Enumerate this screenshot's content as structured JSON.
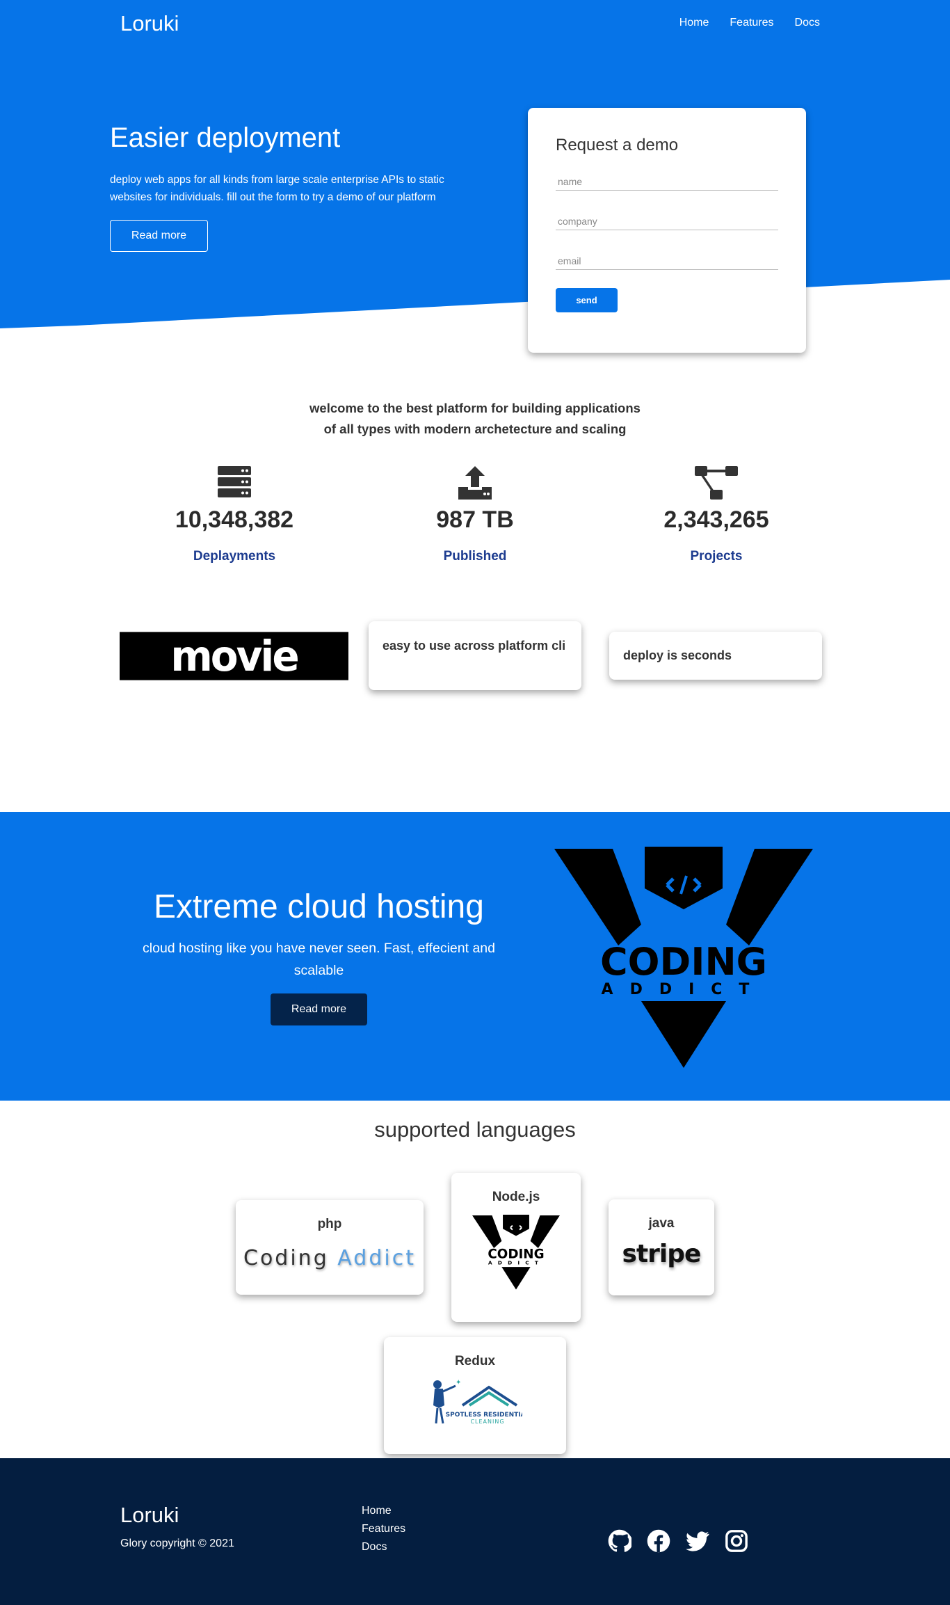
{
  "header": {
    "logo": "Loruki",
    "nav": [
      "Home",
      "Features",
      "Docs"
    ]
  },
  "hero": {
    "title": "Easier deployment",
    "description": "deploy web apps for all kinds from large scale enterprise APIs to static websites for individuals. fill out the form to try a demo of our platform",
    "button": "Read more"
  },
  "demo_form": {
    "title": "Request a demo",
    "name_placeholder": "name",
    "company_placeholder": "company",
    "email_placeholder": "email",
    "send_label": "send"
  },
  "welcome": {
    "line1": "welcome to the best platform for building applications",
    "line2": "of all types with modern archetecture and scaling"
  },
  "stats": [
    {
      "icon": "server-icon",
      "value": "10,348,382",
      "label": "Deplayments"
    },
    {
      "icon": "upload-icon",
      "value": "987 TB",
      "label": "Published"
    },
    {
      "icon": "project-diagram-icon",
      "value": "2,343,265",
      "label": "Projects"
    }
  ],
  "features": {
    "logo_text": "movie hunter",
    "card1": "easy to use across platform cli",
    "card2": "deploy is seconds"
  },
  "cloud": {
    "title": "Extreme cloud hosting",
    "description": "cloud hosting like you have never seen. Fast, effecient and scalable",
    "button": "Read more",
    "logo_word": "CODING",
    "logo_sub": "ADDICT"
  },
  "languages": {
    "title": "supported languages",
    "items": [
      {
        "name": "php",
        "logo_a": "Coding",
        "logo_b": "Addict"
      },
      {
        "name": "Node.js",
        "logo_word": "CODING",
        "logo_sub": "ADDICT"
      },
      {
        "name": "java",
        "logo": "stripe"
      },
      {
        "name": "Redux",
        "logo_line1": "SPOTLESS RESIDENTIAL",
        "logo_line2": "CLEANING"
      }
    ]
  },
  "footer": {
    "logo": "Loruki",
    "copyright": "Glory copyright © 2021",
    "links": [
      "Home",
      "Features",
      "Docs"
    ],
    "social": [
      "github-icon",
      "facebook-icon",
      "twitter-icon",
      "instagram-icon"
    ]
  },
  "colors": {
    "primary": "#0674e8",
    "dark": "#041e40",
    "button_dark": "#04234a",
    "stat_label": "#1c3b8f"
  }
}
